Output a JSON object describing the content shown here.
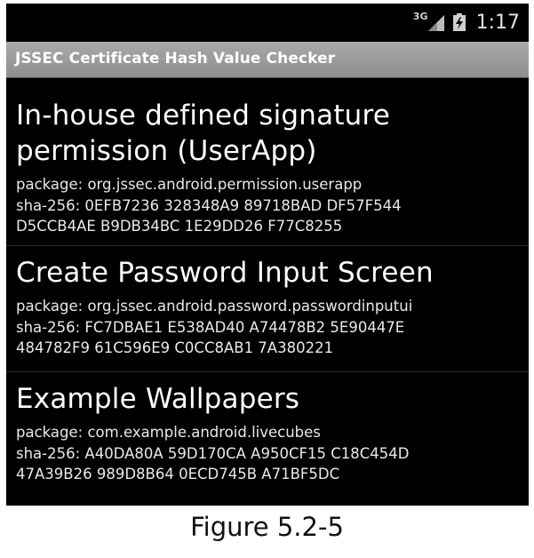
{
  "status_bar": {
    "network_type": "3G",
    "time": "1:17",
    "icons": [
      "signal-icon",
      "battery-icon"
    ]
  },
  "app": {
    "title": "JSSEC Certificate Hash Value Checker"
  },
  "items": [
    {
      "title": "In-house defined signature\npermission (UserApp)",
      "package": "package: org.jssec.android.permission.userapp",
      "sha_line1": "sha-256: 0EFB7236 328348A9 89718BAD DF57F544",
      "sha_line2": "D5CCB4AE B9DB34BC 1E29DD26 F77C8255"
    },
    {
      "title": "Create Password Input Screen",
      "package": "package: org.jssec.android.password.passwordinputui",
      "sha_line1": "sha-256: FC7DBAE1 E538AD40 A74478B2 5E90447E",
      "sha_line2": "484782F9 61C596E9 C0CC8AB1 7A380221"
    },
    {
      "title": "Example Wallpapers",
      "package": "package: com.example.android.livecubes",
      "sha_line1": "sha-256: A40DA80A 59D170CA A950CF15 C18C454D",
      "sha_line2": "47A39B26 989D8B64 0ECD745B A71BF5DC"
    }
  ],
  "caption": "Figure 5.2-5",
  "colors": {
    "background": "#000000",
    "title_bar": "#9a9a9a",
    "text": "#ffffff"
  }
}
